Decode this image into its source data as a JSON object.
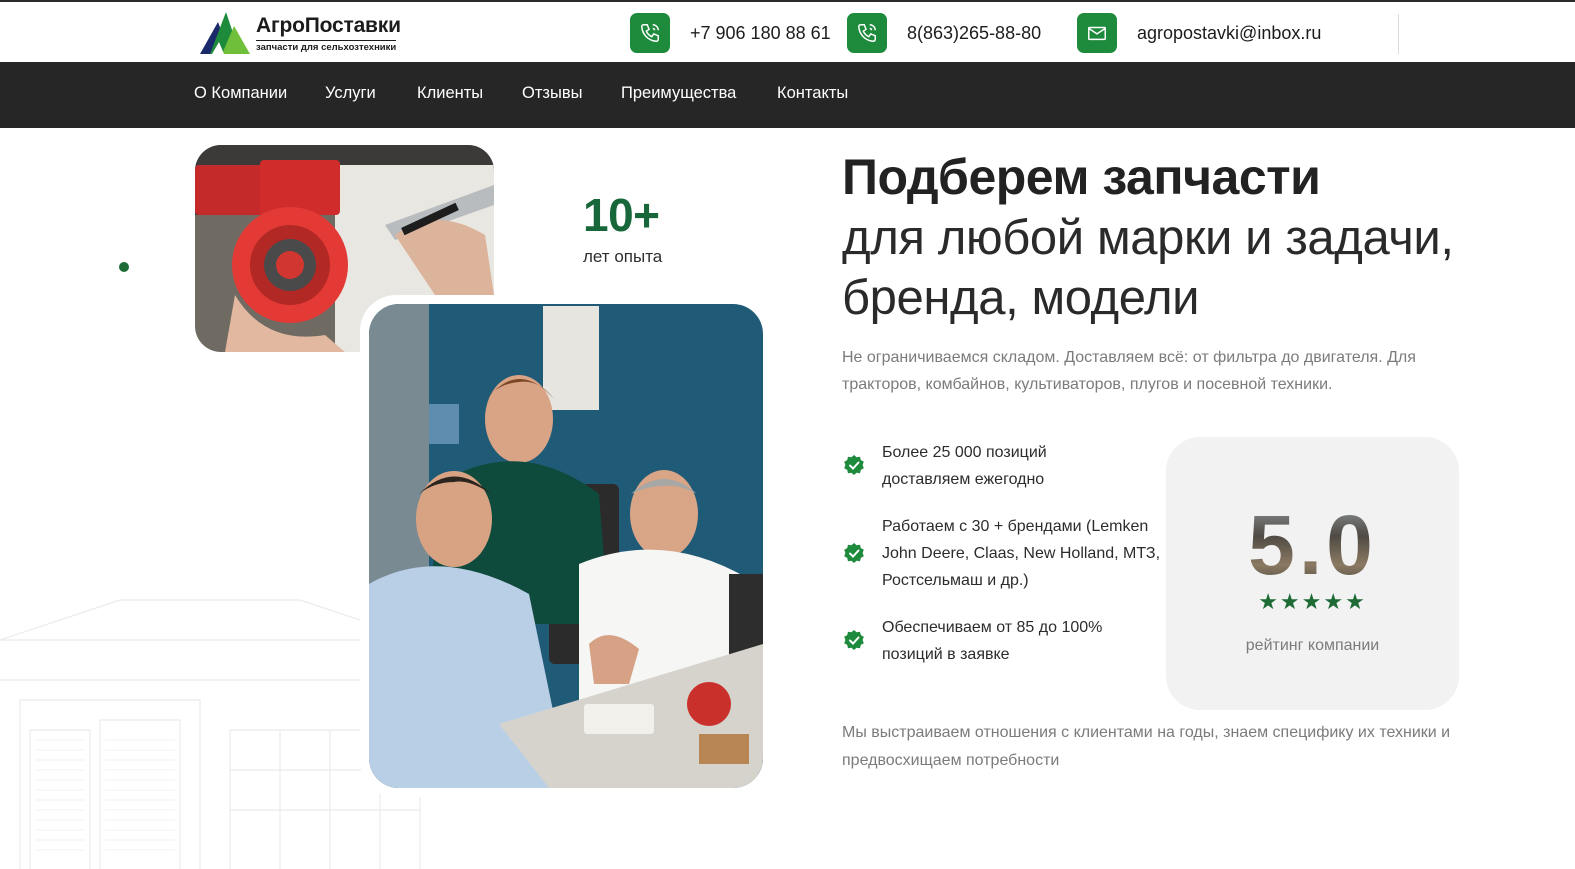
{
  "header": {
    "logo": {
      "title": "АгроПоставки",
      "subtitle": "запчасти для сельхозтехники"
    },
    "contacts": [
      {
        "icon": "phone-icon",
        "text": "+7 906 180 88 61"
      },
      {
        "icon": "phone-icon",
        "text": "8(863)265-88-80"
      },
      {
        "icon": "mail-icon",
        "text": "agropostavki@inbox.ru"
      }
    ]
  },
  "nav": {
    "items": [
      "О Компании",
      "Услуги",
      "Клиенты",
      "Отзывы",
      "Преимущества",
      "Контакты"
    ]
  },
  "hero": {
    "years": {
      "value": "10+",
      "label": "лет опыта"
    },
    "title": "Подберем запчасти",
    "subtitle": "для любой марки и задачи, бренда, модели",
    "lead": "Не ограничиваемся складом. Доставляем всё: от фильтра до двигателя. Для тракторов, комбайнов, культиваторов, плугов и посевной техники.",
    "features": [
      {
        "icon": "check-badge-icon",
        "text": "Более 25 000 позиций доставляем ежегодно"
      },
      {
        "icon": "check-badge-icon",
        "text": "Работаем с 30 + брендами (Lemken John Deere, Claas, New Holland, МТЗ, Ростсельмаш и др.)"
      },
      {
        "icon": "check-badge-icon",
        "text": "Обеспечиваем от 85 до 100% позиций в заявке"
      }
    ],
    "rating": {
      "value": "5.0",
      "stars": 5,
      "stars_text": "★★★★★",
      "label": "рейтинг компании"
    },
    "bottom": "Мы выстраиваем отношения с клиентами на годы, знаем специфику их техники и предвосхищаем потребности"
  },
  "colors": {
    "accent": "#1e8a3c",
    "dark_green": "#17673a",
    "nav_bg": "#262626"
  }
}
